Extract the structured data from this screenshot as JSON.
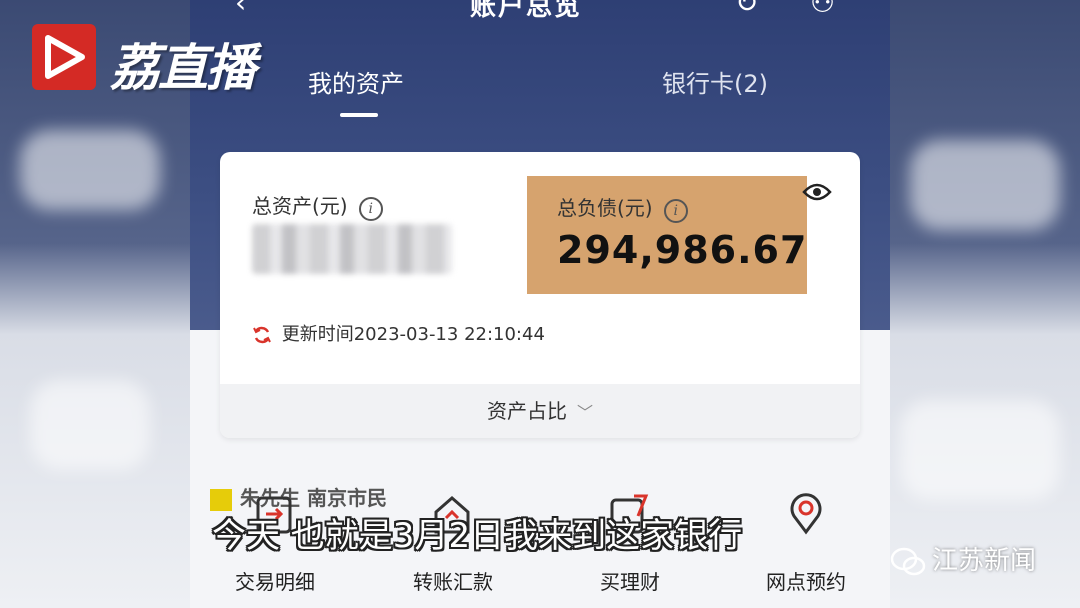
{
  "top_bar": {
    "title": "账户总览"
  },
  "tabs": [
    {
      "label": "我的资产"
    },
    {
      "label": "银行卡(2)"
    }
  ],
  "asset_card": {
    "total_assets_label": "总资产(元)",
    "total_liabilities_label": "总负债(元)",
    "total_liabilities_value": "294,986.67",
    "update_time": "更新时间2023-03-13 22:10:44",
    "ratio_label": "资产占比",
    "debt_highlight_color": "#d6a36e"
  },
  "caption_name": "朱先生  南京市民",
  "shortcuts": [
    {
      "label": "交易明细",
      "icon": "transaction-detail-icon"
    },
    {
      "label": "转账汇款",
      "icon": "transfer-icon"
    },
    {
      "label": "买理财",
      "icon": "wealth-icon"
    },
    {
      "label": "网点预约",
      "icon": "branch-location-icon"
    }
  ],
  "overlays": {
    "broadcaster_logo": "荔直播",
    "subtitle": "今天  也就是3月2日我来到这家银行",
    "watermark": "江苏新闻",
    "logo_color": "#d42a25"
  }
}
